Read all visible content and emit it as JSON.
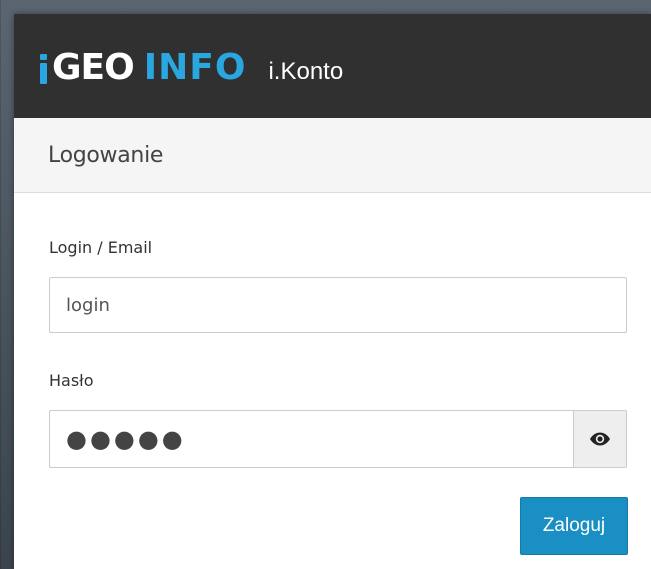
{
  "header": {
    "logo_geo": "GEO",
    "logo_info": "INFO",
    "app_name": "i.Konto",
    "brand_color": "#2aa6e0",
    "header_bg": "#303030"
  },
  "panel": {
    "heading": "Logowanie"
  },
  "form": {
    "login_label": "Login / Email",
    "login_value": "login",
    "password_label": "Hasło",
    "password_value": "●●●●●",
    "show_password_icon": "eye-icon",
    "submit_label": "Zaloguj",
    "submit_color": "#1a8fc4"
  }
}
